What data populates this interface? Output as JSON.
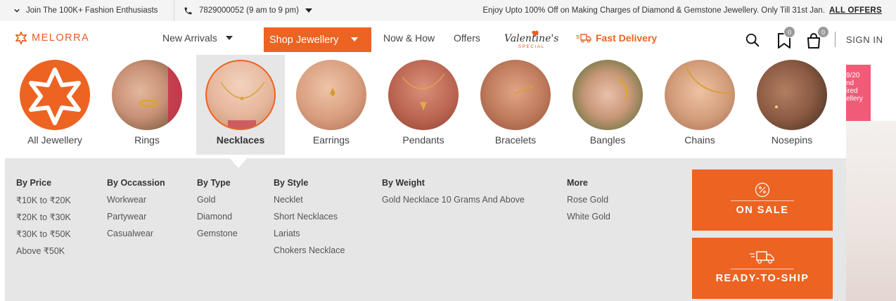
{
  "topbar": {
    "join_text": "Join The 100K+ Fashion Enthusiasts",
    "phone_text": "7829000052 (9 am to 9 pm)",
    "promo_text": "Enjoy Upto 100% Off on Making Charges of Diamond & Gemstone Jewellery. Only Till 31st Jan.",
    "all_offers": "ALL OFFERS"
  },
  "header": {
    "logo_text": "MELORRA",
    "nav": {
      "new_arrivals": "New Arrivals",
      "shop_jewellery": "Shop Jewellery",
      "now_how": "Now & How",
      "offers": "Offers",
      "valentines": "Valentine's",
      "valentines_sub": "SPECIAL",
      "fast_delivery": "Fast Delivery"
    },
    "wishlist_count": "0",
    "cart_count": "0",
    "sign_in": "SIGN IN"
  },
  "categories": [
    {
      "label": "All Jewellery",
      "icon": "star-logo-icon"
    },
    {
      "label": "Rings",
      "icon": "rings-photo"
    },
    {
      "label": "Necklaces",
      "icon": "necklaces-photo",
      "selected": true
    },
    {
      "label": "Earrings",
      "icon": "earrings-photo"
    },
    {
      "label": "Pendants",
      "icon": "pendants-photo"
    },
    {
      "label": "Bracelets",
      "icon": "bracelets-photo"
    },
    {
      "label": "Bangles",
      "icon": "bangles-photo"
    },
    {
      "label": "Chains",
      "icon": "chains-photo"
    },
    {
      "label": "Nosepins",
      "icon": "nosepins-photo"
    }
  ],
  "mega": {
    "by_price": {
      "title": "By Price",
      "items": [
        "₹10K to ₹20K",
        "₹20K to ₹30K",
        "₹30K to ₹50K",
        "Above ₹50K"
      ]
    },
    "by_occasion": {
      "title": "By Occassion",
      "items": [
        "Workwear",
        "Partywear",
        "Casualwear"
      ]
    },
    "by_type": {
      "title": "By Type",
      "items": [
        "Gold",
        "Diamond",
        "Gemstone"
      ]
    },
    "by_style": {
      "title": "By Style",
      "items": [
        "Necklet",
        "Short Necklaces",
        "Lariats",
        "Chokers Necklace"
      ]
    },
    "by_weight": {
      "title": "By Weight",
      "items": [
        "Gold Necklace 10 Grams And Above"
      ]
    },
    "more": {
      "title": "More",
      "items": [
        "Rose Gold",
        "White Gold"
      ]
    },
    "promo_on_sale": "ON SALE",
    "promo_ready_to_ship": "READY-TO-SHIP"
  },
  "side_peek": {
    "lines": [
      "9/20",
      "nd",
      "ired",
      "ellery"
    ]
  },
  "colors": {
    "accent": "#ed6322",
    "panel_bg": "#e6e6e6",
    "topbar_bg": "#f4f4f4"
  }
}
